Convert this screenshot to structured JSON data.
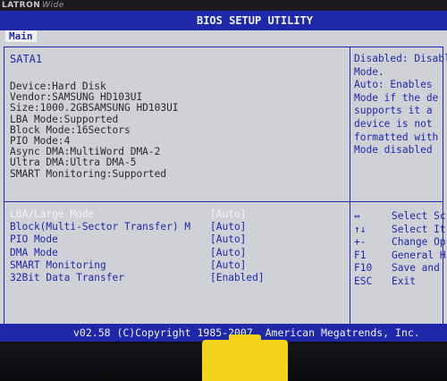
{
  "monitor": {
    "brand": "LATRON",
    "model": "Wide"
  },
  "bios": {
    "title": "BIOS SETUP UTILITY",
    "active_tab": "Main",
    "section_title": "SATA1",
    "info": [
      {
        "label": "Device      ",
        "value": ":Hard Disk"
      },
      {
        "label": "Vendor      ",
        "value": ":SAMSUNG HD103UI"
      },
      {
        "label": "Size        ",
        "value": ":1000.2GBSAMSUNG HD103UI"
      },
      {
        "label": "LBA Mode    ",
        "value": ":Supported"
      },
      {
        "label": "Block Mode",
        "value": ":16Sectors"
      },
      {
        "label": "PIO Mode    ",
        "value": ":4"
      },
      {
        "label": "Async DMA ",
        "value": ":MultiWord DMA-2"
      },
      {
        "label": "Ultra DMA   ",
        "value": ":Ultra DMA-5"
      },
      {
        "label": "SMART Monitoring",
        "value": ":Supported"
      }
    ],
    "settings": [
      {
        "label": "LBA/Large Mode",
        "value": "[Auto]",
        "active": true
      },
      {
        "label": "Block(Multi-Sector Transfer) M",
        "value": "[Auto]",
        "active": false
      },
      {
        "label": "PIO Mode",
        "value": "[Auto]",
        "active": false
      },
      {
        "label": "DMA Mode",
        "value": "[Auto]",
        "active": false
      },
      {
        "label": "SMART Monitoring",
        "value": "[Auto]",
        "active": false
      },
      {
        "label": "32Bit Data Transfer",
        "value": "[Enabled]",
        "active": false
      }
    ],
    "help_lines": [
      "Disabled: Disabl",
      "Mode.",
      "Auto: Enables",
      "Mode if the de",
      "supports it a",
      "device is not",
      "formatted with",
      "Mode disabled"
    ],
    "keys": [
      {
        "key": "↔",
        "action": "Select Sc"
      },
      {
        "key": "↑↓",
        "action": "Select It"
      },
      {
        "key": "+-",
        "action": "Change Op"
      },
      {
        "key": "F1",
        "action": "General H"
      },
      {
        "key": "F10",
        "action": "Save and"
      },
      {
        "key": "ESC",
        "action": "Exit"
      }
    ],
    "footer": "v02.58 (C)Copyright 1985-2007, American Megatrends, Inc.",
    "colors": {
      "blue": "#1f28a8",
      "gray": "#cfd1d6",
      "white": "#f2f2f2"
    }
  }
}
